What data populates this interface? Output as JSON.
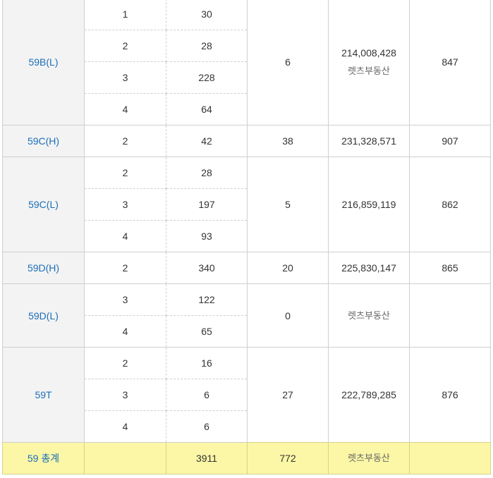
{
  "rows": {
    "b_l": {
      "type": "59B(L)",
      "floors": [
        "1",
        "2",
        "3",
        "4"
      ],
      "units": [
        "30",
        "28",
        "228",
        "64"
      ],
      "competition": "6",
      "price": "214,008,428",
      "watermark": "렛츠부동산",
      "per_pyeong": "847"
    },
    "c_h": {
      "type": "59C(H)",
      "floors": [
        "2"
      ],
      "units": [
        "42"
      ],
      "competition": "38",
      "price": "231,328,571",
      "per_pyeong": "907"
    },
    "c_l": {
      "type": "59C(L)",
      "floors": [
        "2",
        "3",
        "4"
      ],
      "units": [
        "28",
        "197",
        "93"
      ],
      "competition": "5",
      "price": "216,859,119",
      "per_pyeong": "862"
    },
    "d_h": {
      "type": "59D(H)",
      "floors": [
        "2"
      ],
      "units": [
        "340"
      ],
      "competition": "20",
      "price": "225,830,147",
      "per_pyeong": "865"
    },
    "d_l": {
      "type": "59D(L)",
      "floors": [
        "3",
        "4"
      ],
      "units": [
        "122",
        "65"
      ],
      "competition": "0",
      "watermark": "렛츠부동산"
    },
    "t": {
      "type": "59T",
      "floors": [
        "2",
        "3",
        "4"
      ],
      "units": [
        "16",
        "6",
        "6"
      ],
      "competition": "27",
      "price": "222,789,285",
      "per_pyeong": "876"
    }
  },
  "total": {
    "label": "59 총계",
    "units": "3911",
    "competition": "772",
    "watermark": "렛츠부동산"
  }
}
